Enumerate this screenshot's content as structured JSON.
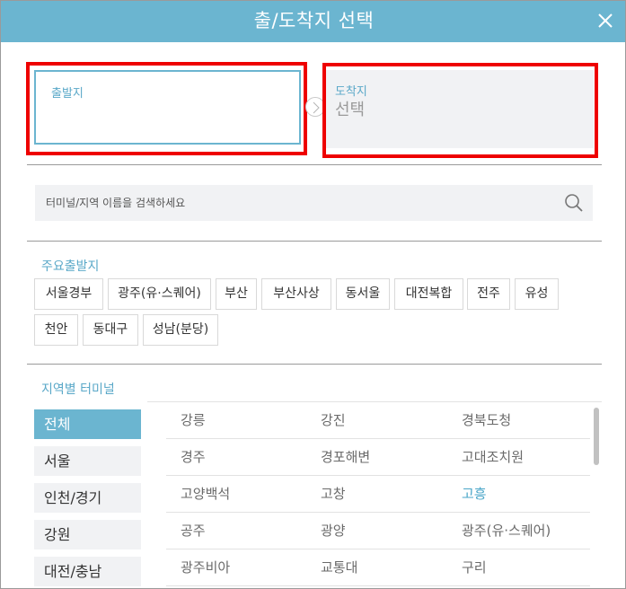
{
  "header": {
    "title": "출/도착지 선택"
  },
  "departure": {
    "label": "출발지",
    "value": ""
  },
  "arrival": {
    "label": "도착지",
    "value": "선택"
  },
  "search": {
    "placeholder": "터미널/지역 이름을 검색하세요",
    "value": ""
  },
  "major": {
    "title": "주요출발지",
    "chips": [
      "서울경부",
      "광주(유·스퀘어)",
      "부산",
      "부산사상",
      "동서울",
      "대전복합",
      "전주",
      "유성",
      "천안",
      "동대구",
      "성남(분당)"
    ]
  },
  "regional": {
    "title": "지역별 터미널",
    "regions": [
      "전체",
      "서울",
      "인천/경기",
      "강원",
      "대전/충남"
    ],
    "active_region": "전체",
    "terminals": [
      [
        "강릉",
        "강진",
        "경북도청"
      ],
      [
        "경주",
        "경포해변",
        "고대조치원"
      ],
      [
        "고양백석",
        "고창",
        "고흥"
      ],
      [
        "공주",
        "광양",
        "광주(유·스퀘어)"
      ],
      [
        "광주비아",
        "교통대",
        "구리"
      ]
    ],
    "highlighted_terminal": "고흥"
  },
  "colors": {
    "accent": "#6bb5d0",
    "highlight_text": "#4aa6c8",
    "annotation_box": "#ee0000",
    "panel_bg": "#f1f2f4"
  },
  "icons": {
    "close": "close-icon",
    "search": "search-icon",
    "swap": "arrow-right-icon"
  }
}
